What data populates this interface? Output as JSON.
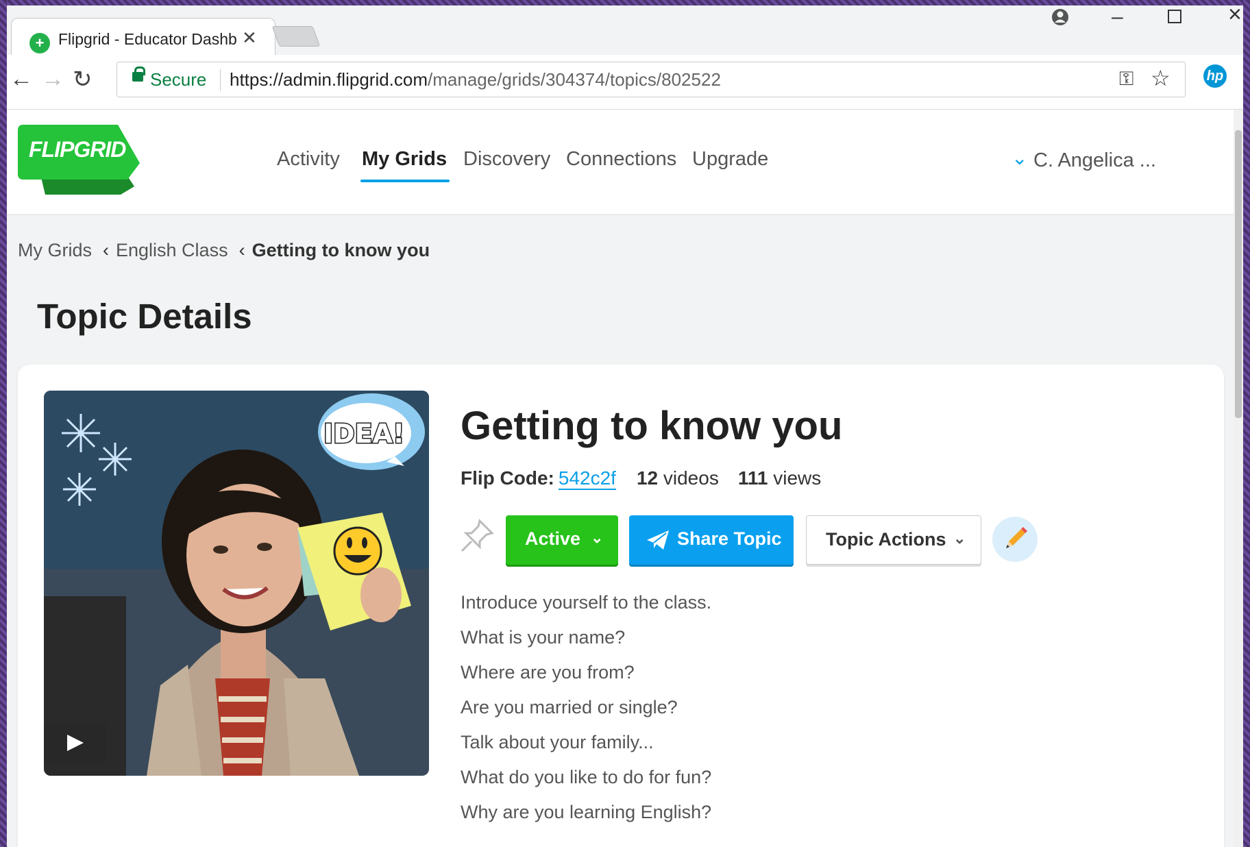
{
  "browser": {
    "tab_title": "Flipgrid - Educator Dashb",
    "tab_close": "✕",
    "secure_label": "Secure",
    "url_scheme": "https://",
    "url_host": "admin.flipgrid.com",
    "url_path": "/manage/grids/304374/topics/802522"
  },
  "header": {
    "logo": "FLIPGRID",
    "nav": [
      "Activity",
      "My Grids",
      "Discovery",
      "Connections",
      "Upgrade"
    ],
    "active_nav": "My Grids",
    "user": "C. Angelica ..."
  },
  "breadcrumb": [
    "My Grids",
    "English Class",
    "Getting to know you"
  ],
  "page_title": "Topic Details",
  "topic": {
    "title": "Getting to know you",
    "flip_code_label": "Flip Code:",
    "flip_code": "542c2f",
    "videos_count": "12",
    "videos_label": "videos",
    "views_count": "111",
    "views_label": "views",
    "status_label": "Active",
    "share_label": "Share Topic",
    "actions_label": "Topic Actions",
    "thumbnail_text": "IDEA!",
    "description": [
      "Introduce yourself to the class.",
      "What is your name?",
      "Where are you from?",
      "Are you married or single?",
      "Talk about your family...",
      "What do you like to do for fun?",
      "Why are you learning English?"
    ]
  },
  "colors": {
    "brand_green": "#27c21a",
    "accent_blue": "#0aa0ef",
    "nav_underline": "#0aa0e6"
  },
  "icons": [
    "back-icon",
    "forward-icon",
    "reload-icon",
    "lock-icon",
    "key-icon",
    "star-icon",
    "hp-icon",
    "menu-icon",
    "pin-icon",
    "share-plane-icon",
    "pencil-icon",
    "play-icon",
    "chevron-down-icon"
  ]
}
